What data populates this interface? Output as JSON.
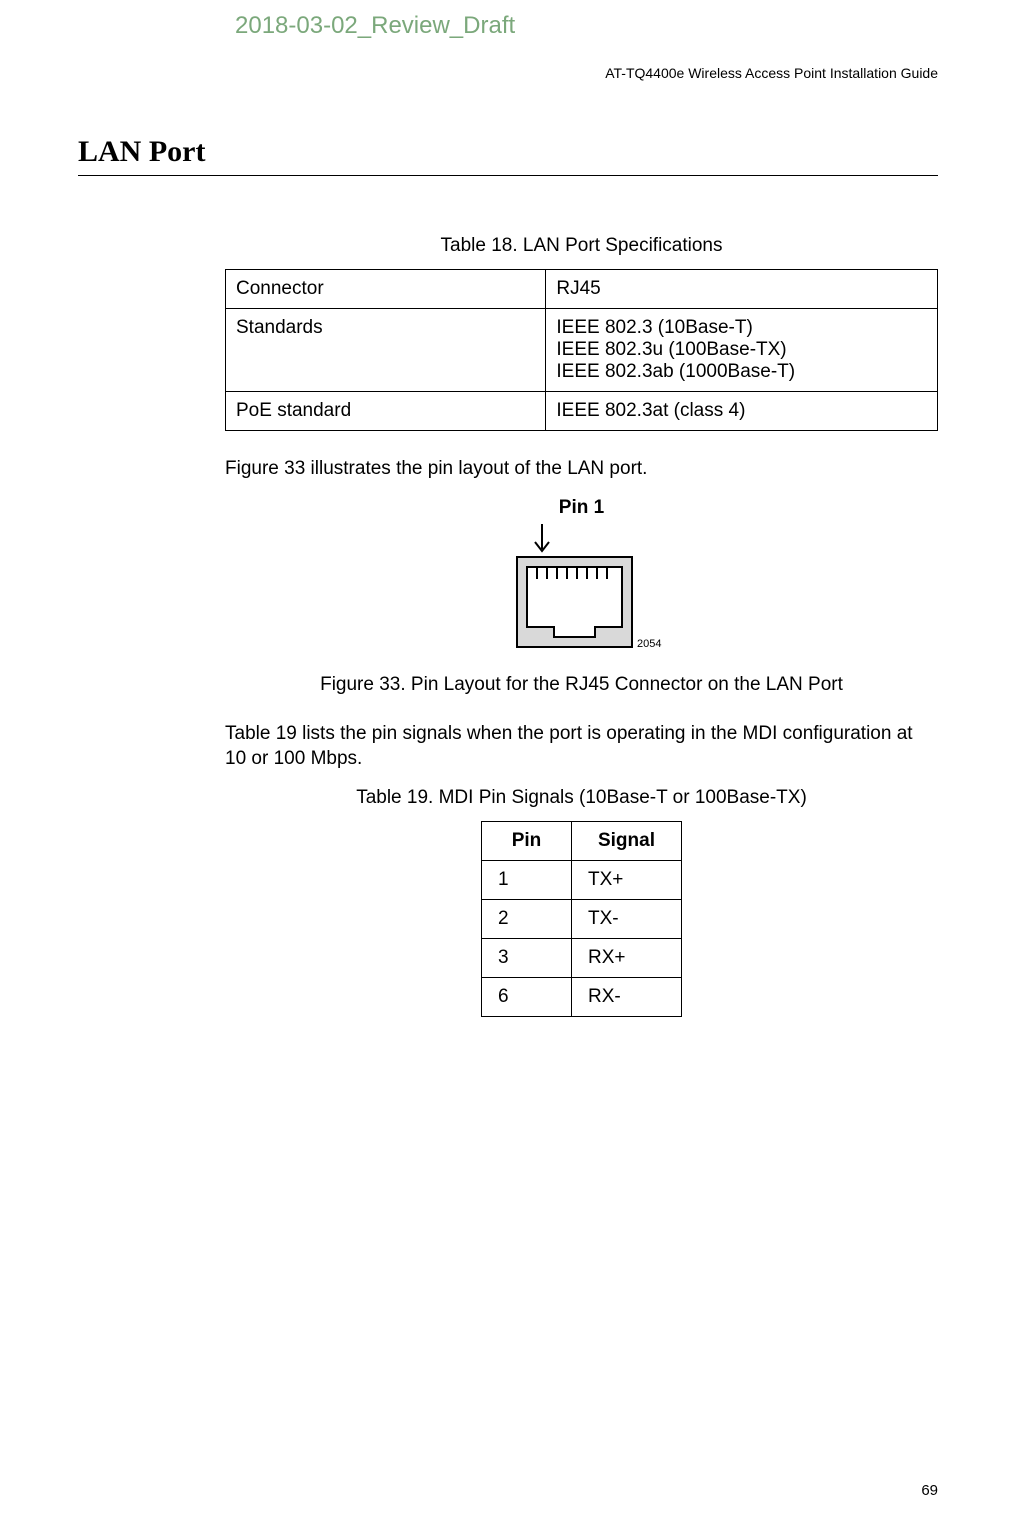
{
  "watermark": "2018-03-02_Review_Draft",
  "header": {
    "doc_title": "AT-TQ4400e Wireless Access Point Installation Guide"
  },
  "section": {
    "title": "LAN Port"
  },
  "table18": {
    "caption": "Table 18.   LAN Port Specifications",
    "rows": [
      {
        "label": "Connector",
        "value": "RJ45"
      },
      {
        "label": "Standards",
        "value": "IEEE 802.3 (10Base-T)\nIEEE 802.3u (100Base-TX)\nIEEE 802.3ab (1000Base-T)"
      },
      {
        "label": "PoE standard",
        "value": "IEEE 802.3at (class 4)"
      }
    ]
  },
  "para1": "Figure 33 illustrates the pin layout of the LAN port.",
  "figure33": {
    "pin_label": "Pin 1",
    "ref_number": "2054",
    "caption": "Figure 33. Pin Layout for the RJ45 Connector on the LAN Port"
  },
  "para2": "Table 19 lists the pin signals when the port is operating in the MDI configuration at 10 or 100 Mbps.",
  "table19": {
    "caption": "Table 19.   MDI Pin Signals (10Base-T or 100Base-TX)",
    "headers": {
      "col1": "Pin",
      "col2": "Signal"
    },
    "rows": [
      {
        "pin": "1",
        "signal": "TX+"
      },
      {
        "pin": "2",
        "signal": "TX-"
      },
      {
        "pin": "3",
        "signal": "RX+"
      },
      {
        "pin": "6",
        "signal": "RX-"
      }
    ]
  },
  "page_number": "69"
}
